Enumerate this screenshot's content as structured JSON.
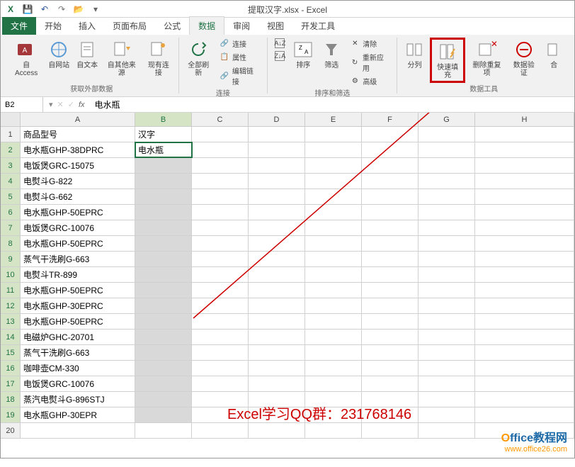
{
  "title": "提取汉字.xlsx - Excel",
  "tabs": {
    "file": "文件",
    "home": "开始",
    "insert": "插入",
    "layout": "页面布局",
    "formulas": "公式",
    "data": "数据",
    "review": "审阅",
    "view": "视图",
    "dev": "开发工具"
  },
  "ribbon": {
    "ext": {
      "access": "自 Access",
      "web": "自网站",
      "text": "自文本",
      "other": "自其他来源",
      "existing": "现有连接",
      "label": "获取外部数据"
    },
    "conn": {
      "refresh": "全部刷新",
      "connections": "连接",
      "props": "属性",
      "editlinks": "编辑链接",
      "label": "连接"
    },
    "sort": {
      "sort": "排序",
      "filter": "筛选",
      "clear": "清除",
      "reapply": "重新应用",
      "advanced": "高级",
      "label": "排序和筛选"
    },
    "tools": {
      "split": "分列",
      "flash": "快速填充",
      "dedup": "删除重复项",
      "datavalid": "数据验证",
      "consolidate": "合",
      "label": "数据工具"
    }
  },
  "namebox": "B2",
  "formula": "电水瓶",
  "col_headers": [
    "A",
    "B",
    "C",
    "D",
    "E",
    "F",
    "G",
    "H"
  ],
  "rows": [
    {
      "n": "1",
      "a": "商品型号",
      "b": "汉字"
    },
    {
      "n": "2",
      "a": "电水瓶GHP-38DPRC",
      "b": "电水瓶"
    },
    {
      "n": "3",
      "a": "电饭煲GRC-15075",
      "b": ""
    },
    {
      "n": "4",
      "a": "电熨斗G-822",
      "b": ""
    },
    {
      "n": "5",
      "a": "电熨斗G-662",
      "b": ""
    },
    {
      "n": "6",
      "a": "电水瓶GHP-50EPRC",
      "b": ""
    },
    {
      "n": "7",
      "a": "电饭煲GRC-10076",
      "b": ""
    },
    {
      "n": "8",
      "a": "电水瓶GHP-50EPRC",
      "b": ""
    },
    {
      "n": "9",
      "a": "蒸气干洗刷G-663",
      "b": ""
    },
    {
      "n": "10",
      "a": "电熨斗TR-899",
      "b": ""
    },
    {
      "n": "11",
      "a": "电水瓶GHP-50EPRC",
      "b": ""
    },
    {
      "n": "12",
      "a": "电水瓶GHP-30EPRC",
      "b": ""
    },
    {
      "n": "13",
      "a": "电水瓶GHP-50EPRC",
      "b": ""
    },
    {
      "n": "14",
      "a": "电磁炉GHC-20701",
      "b": ""
    },
    {
      "n": "15",
      "a": "蒸气干洗刷G-663",
      "b": ""
    },
    {
      "n": "16",
      "a": "咖啡壶CM-330",
      "b": ""
    },
    {
      "n": "17",
      "a": "电饭煲GRC-10076",
      "b": ""
    },
    {
      "n": "18",
      "a": "蒸汽电熨斗G-896STJ",
      "b": ""
    },
    {
      "n": "19",
      "a": "电水瓶GHP-30EPR",
      "b": ""
    },
    {
      "n": "20",
      "a": "",
      "b": ""
    }
  ],
  "annotation": "Excel学习QQ群：231768146",
  "watermark": {
    "brand_o": "O",
    "brand_rest": "ffice教程网",
    "url": "www.office26.com"
  }
}
